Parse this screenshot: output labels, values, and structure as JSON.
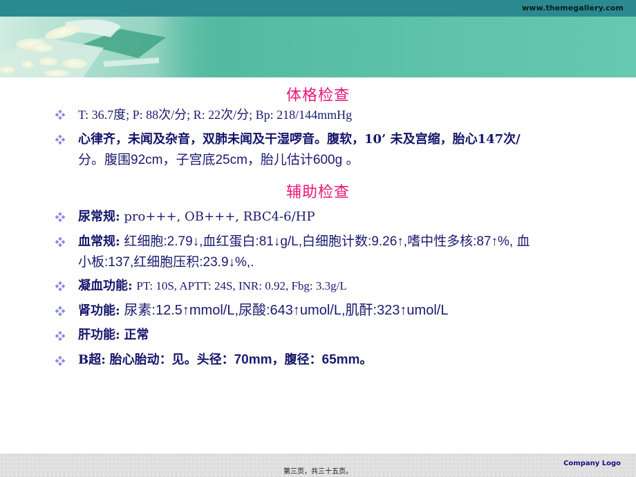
{
  "header": {
    "site_url": "www.themegallery.com",
    "bullet_icon": "diamond-cluster-icon",
    "colors": {
      "top_bar": "#2a8a90",
      "banner": "#55bba2",
      "section_title": "#e8157a",
      "body_text": "#1a1a6e"
    }
  },
  "sections": [
    {
      "title": "体格检查",
      "items": [
        {
          "label": "",
          "text": "T: 36.7度; P: 88次/分; R: 22次/分; Bp: 218/144mmHg"
        },
        {
          "label": "",
          "text_bold": "心律齐，未闻及杂音，双肺未闻及干湿啰音。腹软，10’ 未及宫缩，胎心147次/",
          "text_line2": "分。腹围92cm，子宫底25cm，胎儿估计600g  。"
        }
      ]
    },
    {
      "title": "辅助检查",
      "items": [
        {
          "label": "尿常规:",
          "text": "pro+++, OB+++, RBC4-6/HP"
        },
        {
          "label": "血常规:",
          "text": "红细胞:2.79↓,血红蛋白:81↓g/L,白细胞计数:9.26↑,嗜中性多核:87↑%, 血",
          "text_line2": "小板:137,红细胞压积:23.9↓%,."
        },
        {
          "label": "凝血功能:",
          "text": "PT: 10S, APTT: 24S, INR: 0.92, Fbg: 3.3g/L"
        },
        {
          "label": "肾功能:",
          "text": "尿素:12.5↑mmol/L,尿酸:643↑umol/L,肌酐:323↑umol/L"
        },
        {
          "label": "肝功能:",
          "text": "正常"
        },
        {
          "label": "B超:",
          "text_a": "胎心胎动：见。头径：",
          "text_b": "70mm",
          "text_c": "，腹径：",
          "text_d": "65mm",
          "text_e": "。"
        }
      ]
    }
  ],
  "footer": {
    "page_number": "第三页，共三十五页。",
    "company_logo": "Company Logo"
  }
}
